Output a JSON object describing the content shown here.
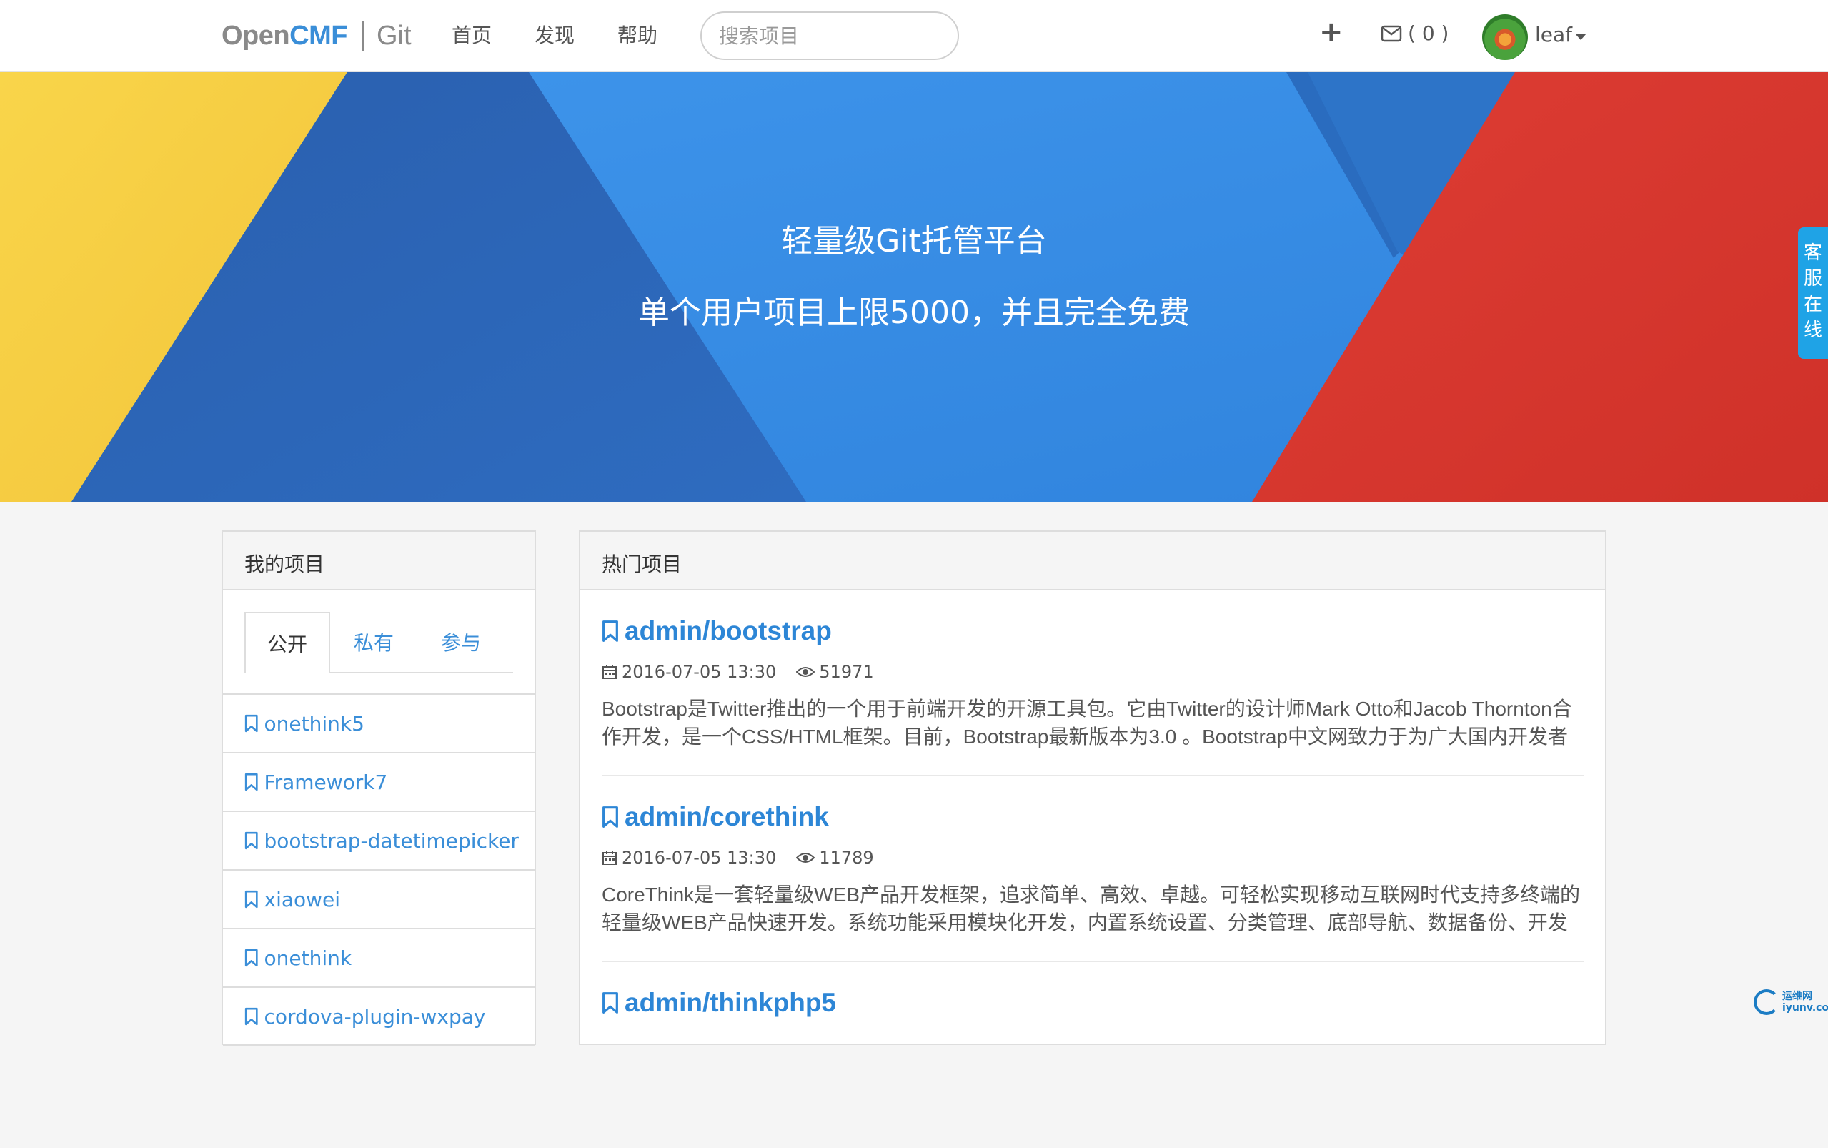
{
  "navbar": {
    "brand_open": "Open",
    "brand_cmf": "CMF",
    "brand_git": "Git",
    "links": [
      "首页",
      "发现",
      "帮助"
    ],
    "search_placeholder": "搜索项目",
    "plus": "+",
    "mail_count": "( 0 )",
    "user_name": "leaf"
  },
  "banner": {
    "title": "轻量级Git托管平台",
    "subtitle": "单个用户项目上限5000，并且完全免费",
    "colors": {
      "yellow": "#f7cf45",
      "dark_blue": "#2c64b4",
      "mid_blue": "#2e7fdc",
      "light_blue": "#3b8ee8",
      "red": "#d8372f"
    }
  },
  "service_tab": [
    "客",
    "服",
    "在",
    "线"
  ],
  "my_projects": {
    "title": "我的项目",
    "tabs": [
      "公开",
      "私有",
      "参与"
    ],
    "items": [
      "onethink5",
      "Framework7",
      "bootstrap-datetimepicker",
      "xiaowei",
      "onethink",
      "cordova-plugin-wxpay"
    ]
  },
  "hot_projects": {
    "title": "热门项目",
    "items": [
      {
        "name": "admin/bootstrap",
        "date": "2016-07-05 13:30",
        "views": "51971",
        "desc": "Bootstrap是Twitter推出的一个用于前端开发的开源工具包。它由Twitter的设计师Mark Otto和Jacob Thornton合作开发，是一个CSS/HTML框架。目前，Bootstrap最新版本为3.0 。Bootstrap中文网致力于为广大国内开发者"
      },
      {
        "name": "admin/corethink",
        "date": "2016-07-05 13:30",
        "views": "11789",
        "desc": "CoreThink是一套轻量级WEB产品开发框架，追求简单、高效、卓越。可轻松实现移动互联网时代支持多终端的轻量级WEB产品快速开发。系统功能采用模块化开发，内置系统设置、分类管理、底部导航、数据备份、开发"
      },
      {
        "name": "admin/thinkphp5",
        "date": "",
        "views": "",
        "desc": ""
      }
    ]
  },
  "watermark": {
    "line1": "运维网",
    "line2": "iyunv.com"
  },
  "accent_color": "#3a8ed8"
}
